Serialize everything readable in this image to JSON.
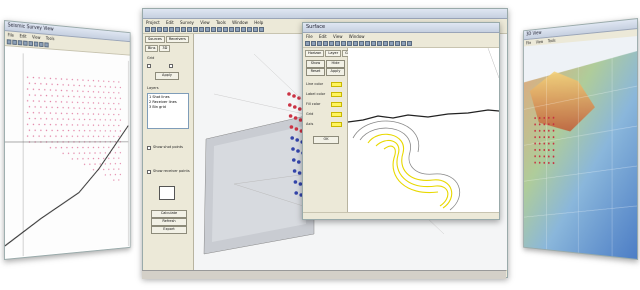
{
  "left_window": {
    "title": "Seismic Survey View",
    "menu": [
      "File",
      "Edit",
      "View",
      "Tools"
    ]
  },
  "center_window": {
    "title": "",
    "menu": [
      "Project",
      "Edit",
      "Survey",
      "View",
      "Tools",
      "Window",
      "Help"
    ],
    "tabs": [
      "Sources",
      "Receivers",
      "Bins",
      "3D"
    ],
    "options_label": "Grid",
    "apply_label": "Apply",
    "list_title": "Layers",
    "list_items": [
      "1 Shot lines",
      "2 Receiver lines",
      "3 Bin grid"
    ],
    "check_label_1": "Show shot points",
    "check_label_2": "Show receiver points",
    "bottom_buttons": [
      "Calculate",
      "Refresh",
      "Export"
    ],
    "status": ""
  },
  "front_window": {
    "title": "Surface",
    "menu": [
      "File",
      "Edit",
      "View",
      "Window"
    ],
    "tabs": [
      "Horizon",
      "Layer",
      "Grid"
    ],
    "buttons": [
      "Show",
      "Hide",
      "Reset",
      "Apply"
    ],
    "color_labels": [
      "Line color",
      "Label color",
      "Fill color",
      "Grid",
      "Axis"
    ],
    "ok_label": "OK",
    "status": ""
  },
  "right_window": {
    "title": "3D View",
    "menu": [
      "File",
      "View",
      "Tools"
    ]
  },
  "taskbar": {
    "text": ""
  },
  "colors": {
    "accent_yellow": "#fff45c",
    "panel": "#ece9d8",
    "terrain_blue": "#5a8fd6",
    "terrain_orange": "#d98a3a"
  }
}
